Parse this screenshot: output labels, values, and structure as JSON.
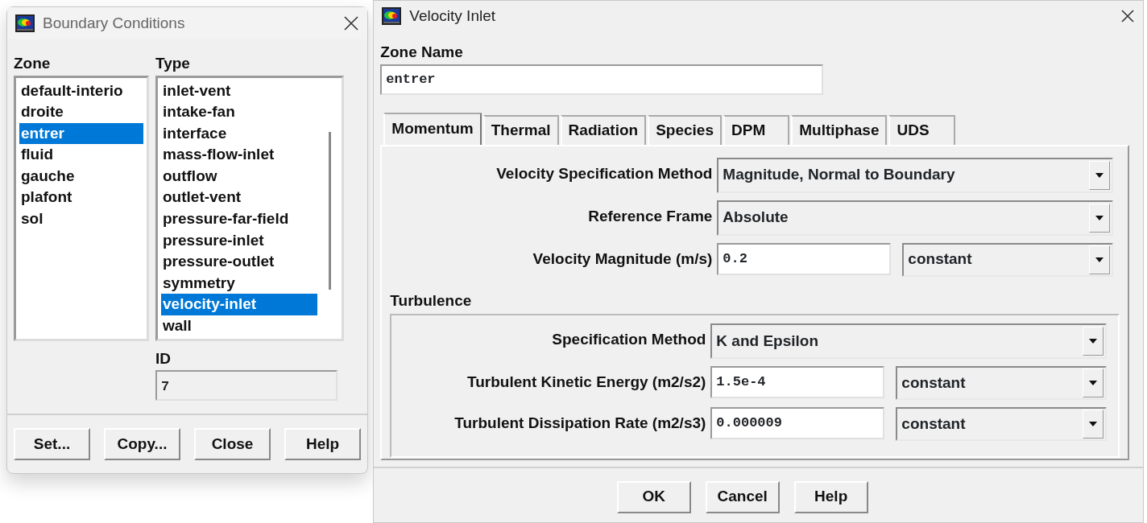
{
  "boundary_conditions": {
    "title": "Boundary Conditions",
    "zone_label": "Zone",
    "zones": [
      {
        "label": "default-interio",
        "selected": false
      },
      {
        "label": "droite",
        "selected": false
      },
      {
        "label": "entrer",
        "selected": true
      },
      {
        "label": "fluid",
        "selected": false
      },
      {
        "label": "gauche",
        "selected": false
      },
      {
        "label": "plafont",
        "selected": false
      },
      {
        "label": "sol",
        "selected": false
      }
    ],
    "type_label": "Type",
    "types": [
      {
        "label": "inlet-vent",
        "selected": false
      },
      {
        "label": "intake-fan",
        "selected": false
      },
      {
        "label": "interface",
        "selected": false
      },
      {
        "label": "mass-flow-inlet",
        "selected": false
      },
      {
        "label": "outflow",
        "selected": false
      },
      {
        "label": "outlet-vent",
        "selected": false
      },
      {
        "label": "pressure-far-field",
        "selected": false
      },
      {
        "label": "pressure-inlet",
        "selected": false
      },
      {
        "label": "pressure-outlet",
        "selected": false
      },
      {
        "label": "symmetry",
        "selected": false
      },
      {
        "label": "velocity-inlet",
        "selected": true
      },
      {
        "label": "wall",
        "selected": false
      }
    ],
    "id_label": "ID",
    "id_value": "7",
    "buttons": [
      "Set...",
      "Copy...",
      "Close",
      "Help"
    ]
  },
  "velocity_inlet": {
    "title": "Velocity Inlet",
    "zone_name_label": "Zone Name",
    "zone_name": "entrer",
    "tabs": [
      {
        "label": "Momentum",
        "selected": true
      },
      {
        "label": "Thermal",
        "selected": false
      },
      {
        "label": "Radiation",
        "selected": false
      },
      {
        "label": "Species",
        "selected": false
      },
      {
        "label": "DPM",
        "selected": false
      },
      {
        "label": "Multiphase",
        "selected": false
      },
      {
        "label": "UDS",
        "selected": false
      }
    ],
    "rows": [
      {
        "kind": "dropdown",
        "label": "Velocity Specification Method",
        "value": "Magnitude, Normal to Boundary"
      },
      {
        "kind": "dropdown",
        "label": "Reference Frame",
        "value": "Absolute"
      },
      {
        "kind": "input",
        "label": "Velocity Magnitude (m/s)",
        "value": "0.2",
        "option": "constant"
      }
    ],
    "turbulence": {
      "title": "Turbulence",
      "rows": [
        {
          "kind": "dropdown",
          "label": "Specification Method",
          "value": "K and Epsilon"
        },
        {
          "kind": "input",
          "label": "Turbulent Kinetic Energy (m2/s2)",
          "value": "1.5e-4",
          "option": "constant"
        },
        {
          "kind": "input",
          "label": "Turbulent Dissipation Rate (m2/s3)",
          "value": "0.000009",
          "option": "constant"
        }
      ]
    },
    "buttons": [
      "OK",
      "Cancel",
      "Help"
    ]
  }
}
